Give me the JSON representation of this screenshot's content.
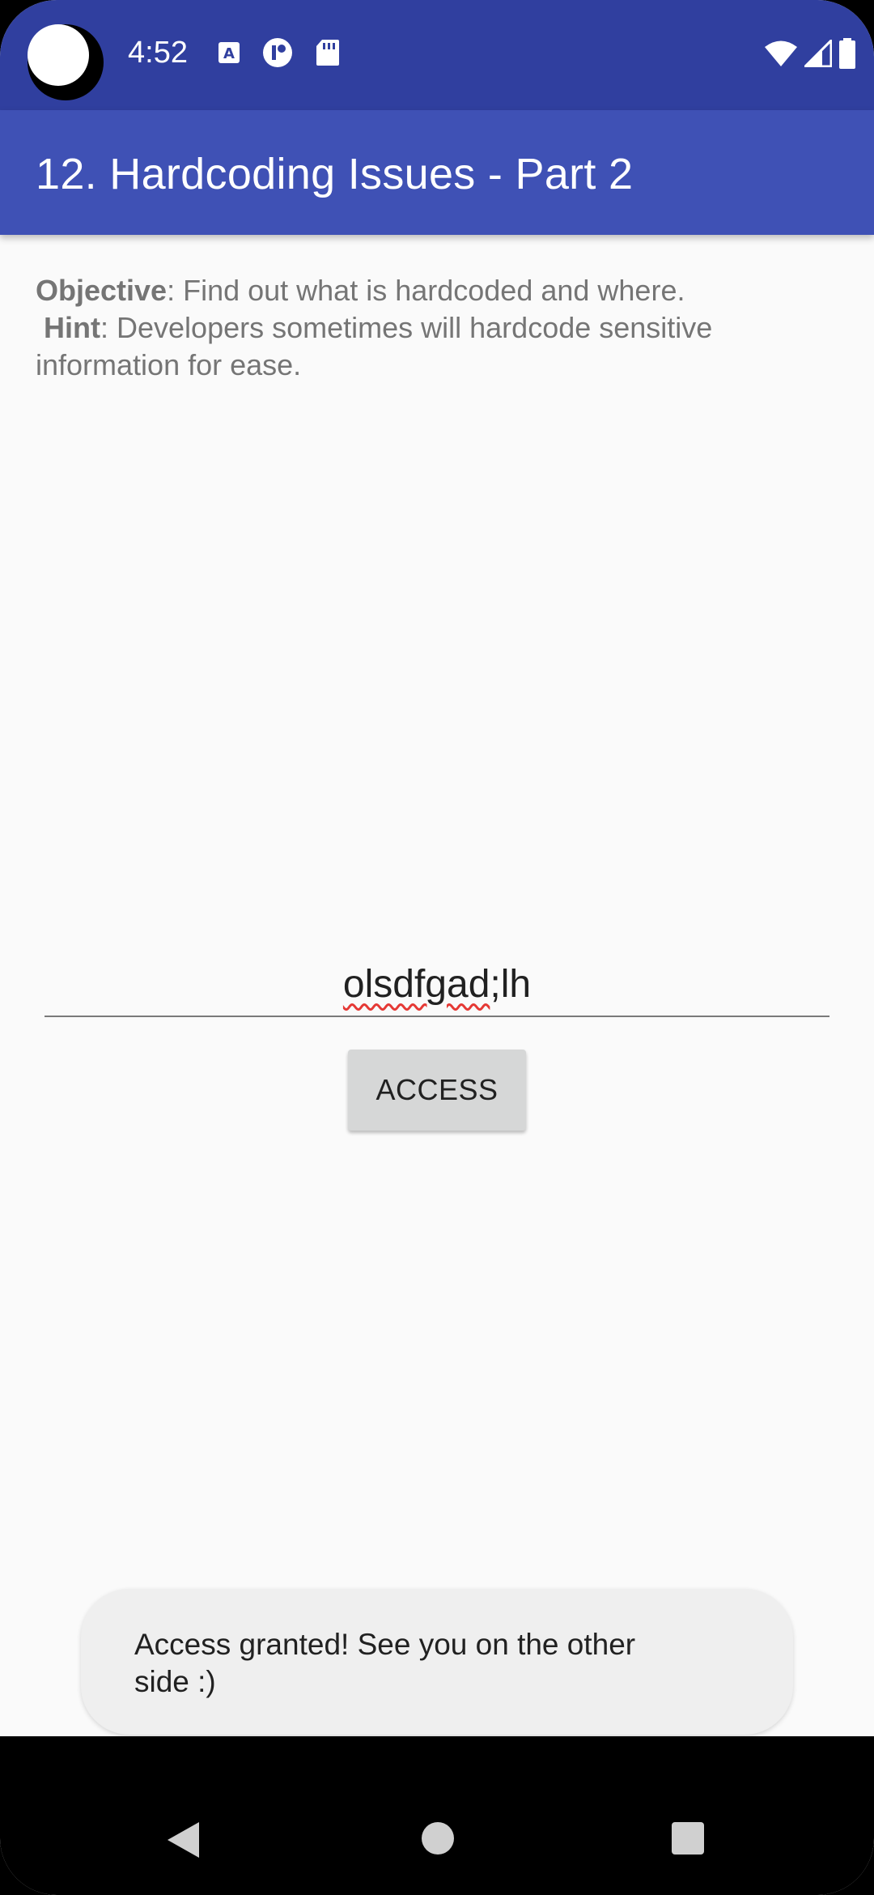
{
  "status_bar": {
    "time": "4:52",
    "left_icons": [
      "text-notification-icon",
      "app-notification-icon",
      "sd-card-icon"
    ],
    "right_icons": [
      "wifi-icon",
      "signal-icon",
      "battery-icon"
    ]
  },
  "app_bar": {
    "title": "12. Hardcoding Issues - Part 2"
  },
  "content": {
    "objective_label": "Objective",
    "objective_text": ": Find out what is hardcoded and where.",
    "hint_label": "Hint",
    "hint_text_line1": ": Developers sometimes will hardcode sensitive",
    "hint_text_line2": "information for ease."
  },
  "input": {
    "value_misspelled_part": "olsdfgad",
    "value_rest": ";lh"
  },
  "button": {
    "access_label": "ACCESS"
  },
  "toast": {
    "line1": "Access granted! See you on the other",
    "line2": "side :)"
  },
  "nav_bar": {
    "buttons": [
      "back-icon",
      "home-icon",
      "recents-icon"
    ]
  },
  "colors": {
    "status_bar": "#303f9f",
    "app_bar": "#3f51b5",
    "background": "#fafafa",
    "button": "#d6d7d7",
    "toast": "#efefef"
  }
}
